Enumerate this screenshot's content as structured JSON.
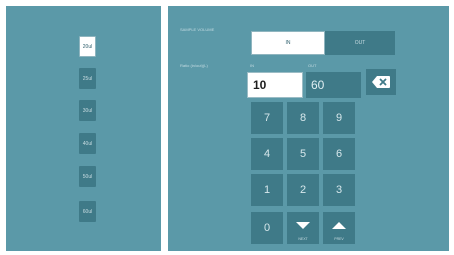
{
  "volume_list": {
    "items": [
      {
        "label": "20ul",
        "selected": true
      },
      {
        "label": "25ul",
        "selected": false
      },
      {
        "label": "30ul",
        "selected": false
      },
      {
        "label": "40ul",
        "selected": false
      },
      {
        "label": "50ul",
        "selected": false
      },
      {
        "label": "60ul",
        "selected": false
      }
    ]
  },
  "header": {
    "caption": "SAMPLE VOLUME"
  },
  "mode_toggle": {
    "left_label": "IN",
    "right_label": "OUT"
  },
  "ratio": {
    "label": "Ratio (in/out)(L)",
    "in_caption": "IN",
    "out_caption": "OUT",
    "in_value": "10",
    "out_value": "60"
  },
  "keypad": {
    "keys": [
      "7",
      "8",
      "9",
      "4",
      "5",
      "6",
      "1",
      "2",
      "3",
      "0"
    ],
    "down_label": "NEXT",
    "up_label": "PREV"
  },
  "icons": {
    "backspace": "backspace-icon",
    "down": "arrow-down-icon",
    "up": "arrow-up-icon"
  },
  "colors": {
    "panel_bg": "#5b99a8",
    "button_bg": "#3f7a88",
    "selected_bg": "#ffffff"
  }
}
